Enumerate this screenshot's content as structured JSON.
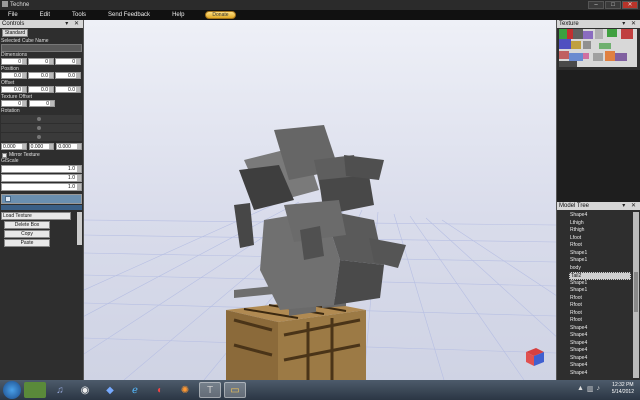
{
  "window": {
    "title": "Techne",
    "minimize": "–",
    "maximize": "□",
    "close": "✕"
  },
  "menu": {
    "items": [
      "File",
      "Edit",
      "Tools",
      "Send Feedback",
      "Help"
    ],
    "donate": "Donate"
  },
  "controls": {
    "title": "Controls",
    "panel_buttons": "▾ ✕",
    "standard": "Standard",
    "selected_cube_name_label": "Selected Cube Name",
    "selected_cube_name": "",
    "dimensions_label": "Dimensions",
    "dimensions": [
      "0",
      "0",
      "0"
    ],
    "position_label": "Position",
    "position": [
      "0.0",
      "0.0",
      "0.0"
    ],
    "offset_label": "Offset",
    "offset": [
      "0.0",
      "0.0",
      "0.0"
    ],
    "texture_offset_label": "Texture Offset",
    "texture_offset": [
      "0",
      "0"
    ],
    "rotation_label": "Rotation",
    "rotation_values": [
      "0.000",
      "0.000",
      "0.000"
    ],
    "mirror_texture": "Mirror Texture",
    "glscale_label": "GlScale",
    "glscale": [
      "1.0",
      "1.0",
      "1.0"
    ],
    "buttons": [
      "Load Texture",
      "Delete Box",
      "Copy",
      "Paste"
    ]
  },
  "texture": {
    "title": "Texture",
    "panel_buttons": "▾ ✕"
  },
  "model_tree": {
    "title": "Model Tree",
    "panel_buttons": "▾ ✕",
    "items": [
      "Shape4",
      "Lthigh",
      "Rthigh",
      "Lfoot",
      "Rfoot",
      "Shape1",
      "Shape1",
      "body",
      "Tail2",
      "Shape1",
      "Shape1",
      "Rfoot",
      "Rfoot",
      "Rfoot",
      "Rfoot",
      "Shape4",
      "Shape4",
      "Shape4",
      "Shape4",
      "Shape4",
      "Shape4",
      "Shape4"
    ],
    "selected_index": 8
  },
  "taskbar": {
    "time": "12:32 PM",
    "date": "5/14/2012",
    "apps": [
      "start-orb",
      "minecraft",
      "itunes",
      "media-player",
      "app-blue",
      "internet-explorer",
      "chrome",
      "firefox",
      "techne",
      "explorer"
    ]
  },
  "colors": {
    "accent_selection": "#cfcfcf",
    "donate": "#f0c040",
    "sky": "#e6e9f3"
  }
}
